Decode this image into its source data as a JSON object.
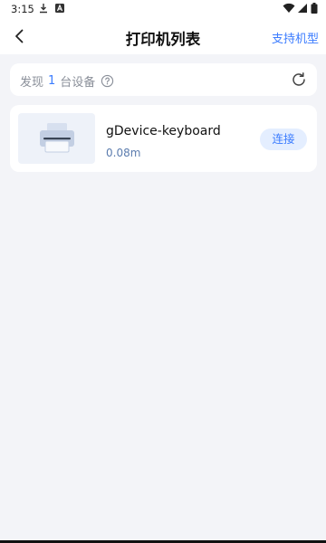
{
  "status_bar": {
    "time": "3:15",
    "icons": [
      "download-icon",
      "text-icon",
      "wifi-icon",
      "signal-icon",
      "battery-icon"
    ]
  },
  "header": {
    "title": "打印机列表",
    "support_link": "支持机型",
    "back_icon": "chevron-left-icon"
  },
  "found": {
    "prefix": "发现",
    "count": "1",
    "suffix": "台设备",
    "help_icon": "question-circle-icon",
    "refresh_icon": "refresh-icon"
  },
  "devices": [
    {
      "name": "gDevice-keyboard",
      "distance": "0.08m",
      "connect_label": "连接",
      "image_icon": "printer-icon"
    }
  ],
  "colors": {
    "accent": "#3b7cff",
    "page_bg": "#f3f4f8",
    "card_bg": "#ffffff",
    "connect_bg": "#e4eeff",
    "muted_text": "#8a8f99"
  }
}
